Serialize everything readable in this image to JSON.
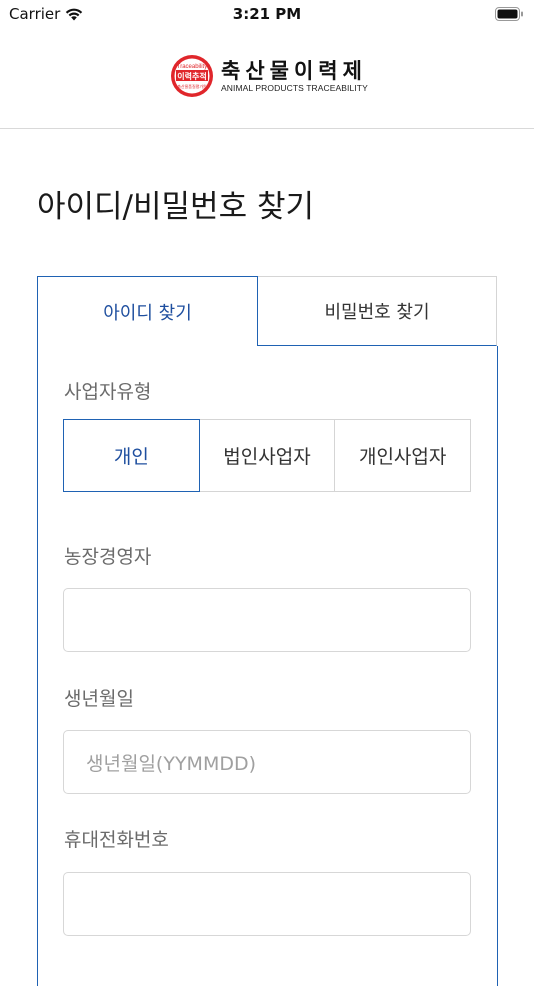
{
  "status_bar": {
    "carrier": "Carrier",
    "time": "3:21 PM"
  },
  "header": {
    "logo_badge_top": "Traceability",
    "logo_badge_main": "이력추적",
    "logo_title": "축산물이력제",
    "logo_subtitle": "ANIMAL PRODUCTS TRACEABILITY"
  },
  "page": {
    "title": "아이디/비밀번호 찾기"
  },
  "tabs": [
    {
      "label": "아이디 찾기",
      "active": true
    },
    {
      "label": "비밀번호 찾기",
      "active": false
    }
  ],
  "form": {
    "business_type_label": "사업자유형",
    "business_types": [
      {
        "label": "개인",
        "selected": true
      },
      {
        "label": "법인사업자",
        "selected": false
      },
      {
        "label": "개인사업자",
        "selected": false
      }
    ],
    "farm_manager_label": "농장경영자",
    "farm_manager_value": "",
    "birth_label": "생년월일",
    "birth_placeholder": "생년월일(YYMMDD)",
    "phone_label": "휴대전화번호",
    "phone_value": ""
  },
  "colors": {
    "accent": "#1f62b3",
    "accent_text": "#1f4f9f",
    "logo_red": "#e0262b"
  }
}
